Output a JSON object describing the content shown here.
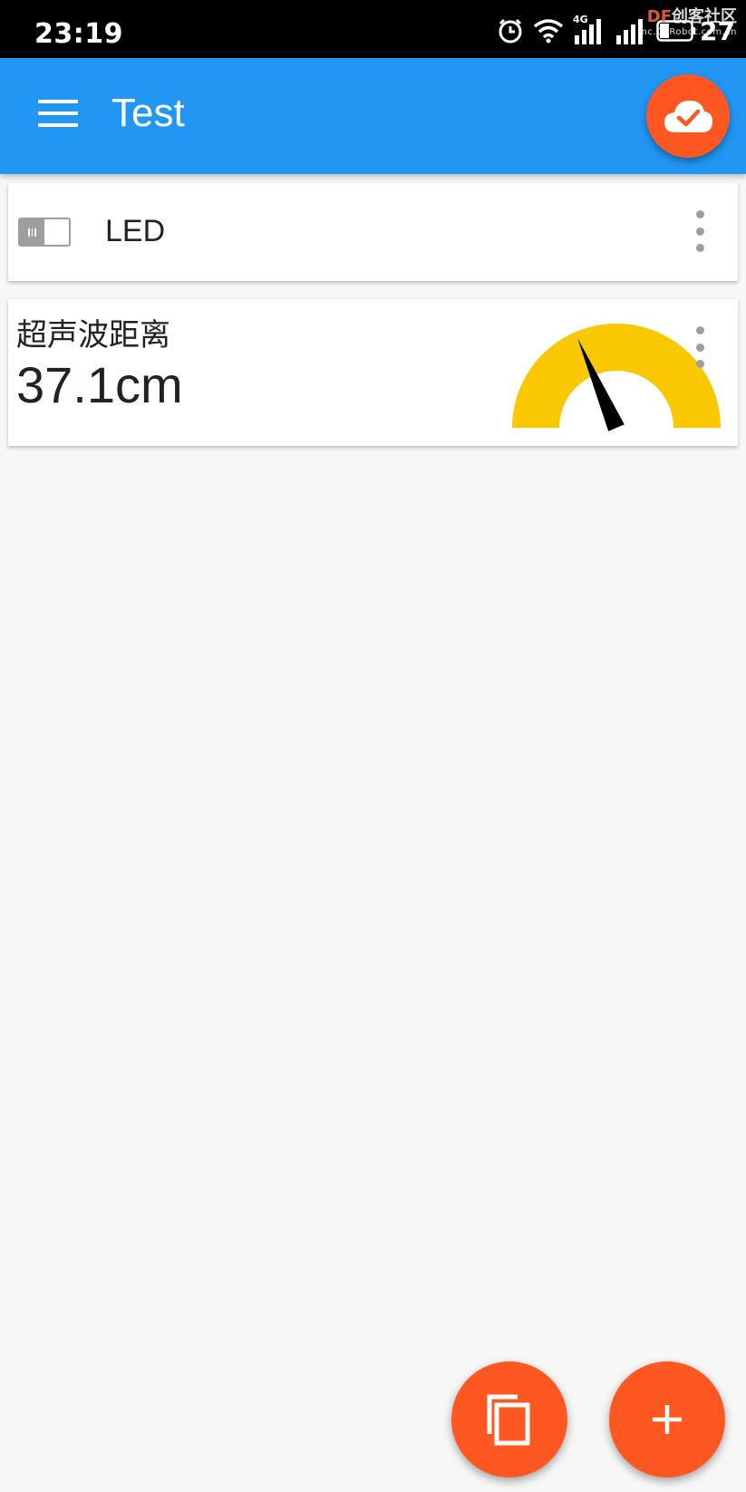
{
  "status_bar": {
    "time": "23:19",
    "network_label": "4G",
    "battery_text": "27",
    "watermark_brand_df": "DF",
    "watermark_brand_rest": "创客社区",
    "watermark_url": "mc.DFRobot.com.cn"
  },
  "app_bar": {
    "title": "Test",
    "menu_icon": "hamburger-menu-icon",
    "sync_icon": "cloud-check-icon"
  },
  "widgets": {
    "led": {
      "label": "LED",
      "switch_on": false
    },
    "distance": {
      "title": "超声波距离",
      "value": "37.1cm",
      "gauge_fraction": 0.37
    }
  },
  "fabs": {
    "copy_icon": "copy-icon",
    "add_icon": "plus-icon"
  },
  "colors": {
    "app_bar": "#2196f3",
    "accent": "#ff5722",
    "gauge": "#f9c800"
  }
}
